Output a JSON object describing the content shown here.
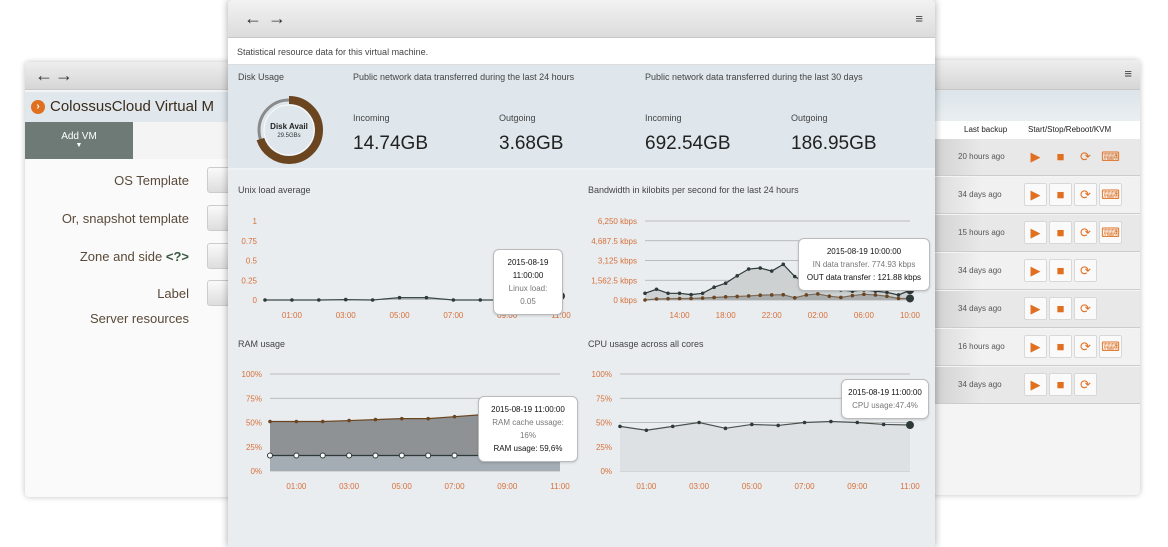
{
  "left_window": {
    "title": "ColossusCloud Virtual M",
    "tab": "Add VM",
    "form_labels": [
      "OS Template",
      "Or, snapshot template",
      "Zone and side",
      "Label",
      "Server resources"
    ],
    "help_marker": "<?>"
  },
  "right_window": {
    "headers": {
      "last_backup": "Last backup",
      "actions": "Start/Stop/Reboot/KVM"
    },
    "rows": [
      {
        "last_backup": "20 hours ago",
        "kvm": true
      },
      {
        "last_backup": "34 days ago",
        "kvm": true
      },
      {
        "last_backup": "15 hours ago",
        "kvm": true
      },
      {
        "last_backup": "34 days ago",
        "kvm": false
      },
      {
        "last_backup": "34 days ago",
        "kvm": false
      },
      {
        "last_backup": "16 hours ago",
        "kvm": true
      },
      {
        "last_backup": "34 days ago",
        "kvm": false
      }
    ],
    "accent": "#e07020"
  },
  "center_window": {
    "subtitle": "Statistical resource data for this virtual machine.",
    "disk": {
      "title": "Disk Usage",
      "label": "Disk Avail",
      "value": "29.5GBs",
      "used_fraction": 0.7,
      "used_color": "#6b4420",
      "free_color": "#8a8a8a"
    },
    "net24": {
      "title": "Public network data transferred during the last 24 hours",
      "incoming_label": "Incoming",
      "incoming": "14.74GB",
      "outgoing_label": "Outgoing",
      "outgoing": "3.68GB"
    },
    "net30": {
      "title": "Public network data transferred during the last 30 days",
      "incoming_label": "Incoming",
      "incoming": "692.54GB",
      "outgoing_label": "Outgoing",
      "outgoing": "186.95GB"
    },
    "tooltips": {
      "load": {
        "time": "2015-08-19 11:00:00",
        "line1": "Linux load: 0.05"
      },
      "bw": {
        "time": "2015-08-19   10:00:00",
        "line1": "IN data transfer. 774.93 kbps",
        "line2": "OUT data transfer : 121.88 kbps"
      },
      "ram": {
        "time": "2015-08-19  11:00:00",
        "line1": "RAM cache ussage: 16%",
        "line2": "RAM usage: 59,6%"
      },
      "cpu": {
        "time": "2015-08-19 11:00:00",
        "line1": "CPU usage:47.4%"
      }
    }
  },
  "chart_data": [
    {
      "id": "load",
      "type": "line",
      "title": "Unix load average",
      "x": [
        "00:00",
        "01:00",
        "02:00",
        "03:00",
        "04:00",
        "05:00",
        "06:00",
        "07:00",
        "08:00",
        "09:00",
        "10:00",
        "11:00"
      ],
      "xticks": [
        "01:00",
        "03:00",
        "05:00",
        "07:00",
        "09:00",
        "11:00"
      ],
      "yticks": [
        "0",
        "0.25",
        "0.5",
        "0.75",
        "1"
      ],
      "ylim": [
        0,
        1
      ],
      "grid": false,
      "series": [
        {
          "values": [
            0,
            0,
            0,
            0.005,
            0,
            0.03,
            0.03,
            0,
            0,
            0,
            0.01,
            0.05
          ]
        }
      ]
    },
    {
      "id": "bw",
      "type": "area",
      "title": "Bandwidth in kilobits per second for the last 24 hours",
      "x": [
        "11:00",
        "12:00",
        "13:00",
        "14:00",
        "15:00",
        "16:00",
        "17:00",
        "18:00",
        "19:00",
        "20:00",
        "21:00",
        "22:00",
        "23:00",
        "00:00",
        "01:00",
        "02:00",
        "03:00",
        "04:00",
        "05:00",
        "06:00",
        "07:00",
        "08:00",
        "09:00",
        "10:00"
      ],
      "xticks": [
        "14:00",
        "18:00",
        "22:00",
        "02:00",
        "06:00",
        "10:00"
      ],
      "yticks": [
        "0 kbps",
        "1,562.5 kbps",
        "3,125 kbps",
        "4,687.5 kbps",
        "6,250 kbps"
      ],
      "ylim": [
        0,
        6250
      ],
      "grid": true,
      "series": [
        {
          "name": "IN data transfer",
          "values": [
            530,
            850,
            530,
            530,
            425,
            530,
            1010,
            1330,
            1915,
            2450,
            2530,
            2290,
            2820,
            1860,
            1300,
            1000,
            900,
            800,
            700,
            800,
            700,
            600,
            400,
            775
          ]
        },
        {
          "name": "OUT data transfer",
          "values": [
            0,
            80,
            100,
            110,
            120,
            150,
            200,
            250,
            280,
            320,
            380,
            400,
            420,
            170,
            400,
            480,
            300,
            200,
            350,
            450,
            400,
            300,
            120,
            122
          ]
        }
      ]
    },
    {
      "id": "ram",
      "type": "area",
      "title": "RAM usage",
      "x": [
        "00:00",
        "01:00",
        "02:00",
        "03:00",
        "04:00",
        "05:00",
        "06:00",
        "07:00",
        "08:00",
        "09:00",
        "10:00",
        "11:00"
      ],
      "xticks": [
        "01:00",
        "03:00",
        "05:00",
        "07:00",
        "09:00",
        "11:00"
      ],
      "yticks": [
        "0%",
        "25%",
        "50%",
        "75%",
        "100%"
      ],
      "ylim": [
        0,
        100
      ],
      "grid": true,
      "series": [
        {
          "name": "RAM usage",
          "values": [
            51,
            51,
            51,
            52,
            53,
            54,
            54,
            56,
            58,
            59,
            59.6,
            59.6
          ]
        },
        {
          "name": "RAM cache usage",
          "values": [
            16,
            16,
            16,
            16,
            16,
            16,
            16,
            16,
            16,
            16,
            16,
            16
          ]
        }
      ]
    },
    {
      "id": "cpu",
      "type": "area",
      "title": "CPU usasge across all cores",
      "x": [
        "00:00",
        "01:00",
        "02:00",
        "03:00",
        "04:00",
        "05:00",
        "06:00",
        "07:00",
        "08:00",
        "09:00",
        "10:00",
        "11:00"
      ],
      "xticks": [
        "01:00",
        "03:00",
        "05:00",
        "07:00",
        "09:00",
        "11:00"
      ],
      "yticks": [
        "0%",
        "25%",
        "50%",
        "75%",
        "100%"
      ],
      "ylim": [
        0,
        100
      ],
      "grid": true,
      "series": [
        {
          "name": "CPU usage",
          "values": [
            46,
            42,
            46,
            50,
            44,
            48,
            47,
            50,
            51,
            50,
            48,
            47.4
          ]
        }
      ]
    }
  ]
}
